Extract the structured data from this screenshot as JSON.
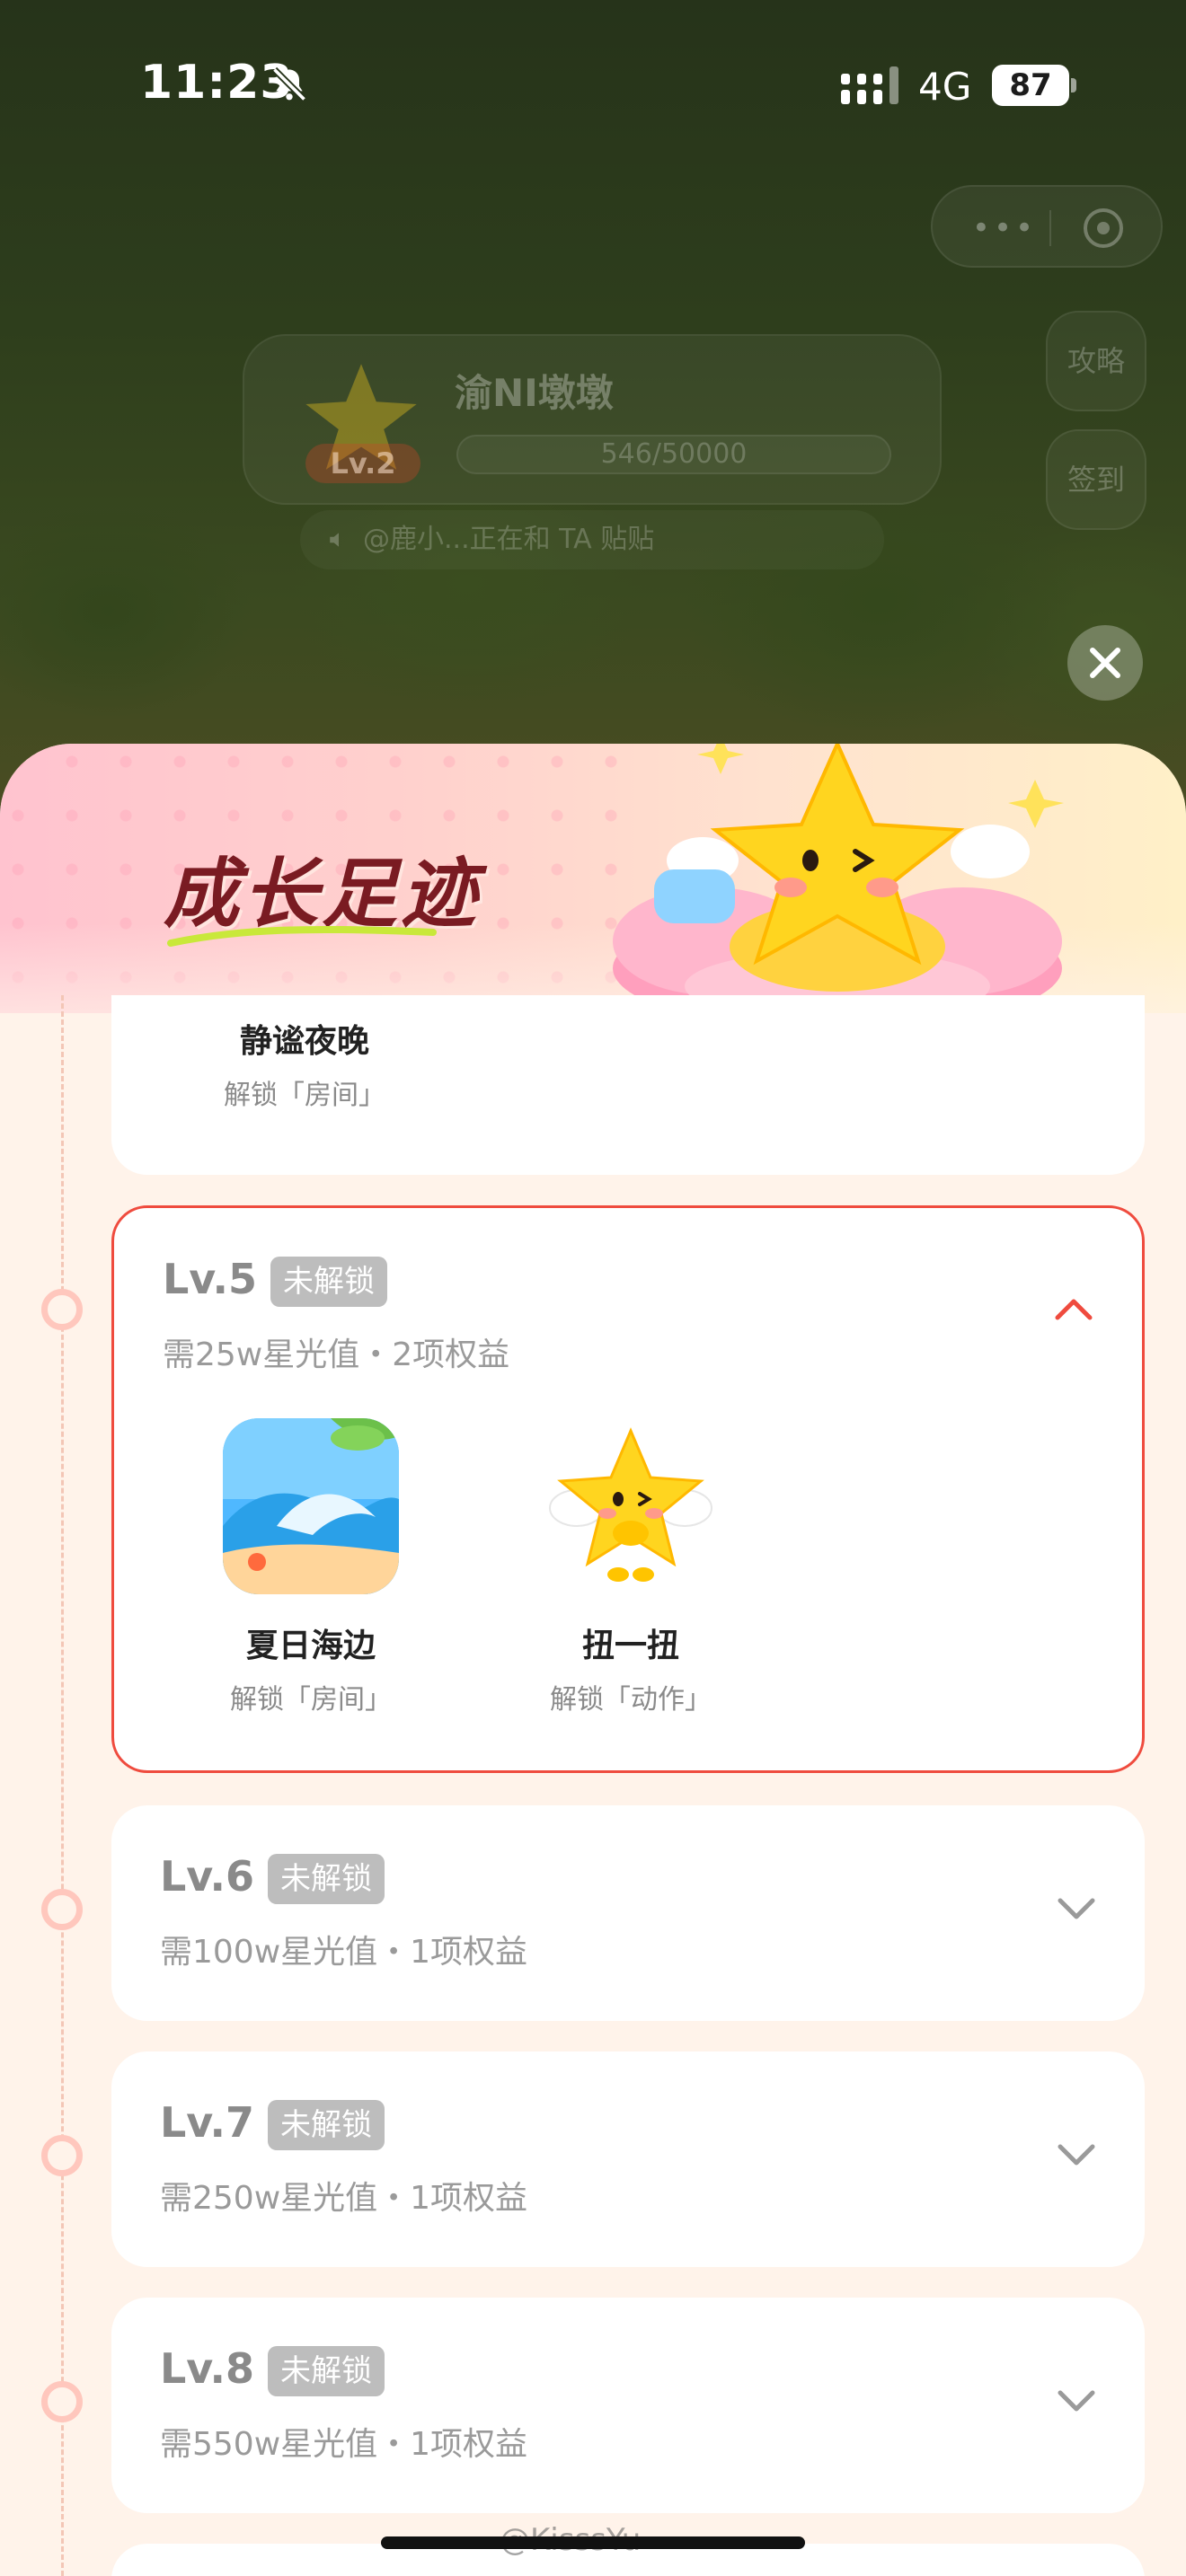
{
  "status_bar": {
    "time": "11:23",
    "network": "4G",
    "battery": "87"
  },
  "background": {
    "profile_name": "渝NI墩墩",
    "profile_level": "Lv.2",
    "profile_progress": "546/50000",
    "side_buttons": [
      "攻略",
      "签到"
    ],
    "notice": "@鹿小...正在和 TA 贴贴",
    "capsule_more": "•••"
  },
  "sheet": {
    "title": "成长足迹",
    "prev_card": {
      "reward_name": "静谧夜晚",
      "reward_sub": "解锁「房间」"
    },
    "levels": [
      {
        "level": "Lv.5",
        "badge": "未解锁",
        "requirement": "需25w星光值・2项权益",
        "expanded": true,
        "rewards": [
          {
            "name": "夏日海边",
            "sub": "解锁「房间」"
          },
          {
            "name": "扭一扭",
            "sub": "解锁「动作」"
          }
        ]
      },
      {
        "level": "Lv.6",
        "badge": "未解锁",
        "requirement": "需100w星光值・1项权益",
        "expanded": false
      },
      {
        "level": "Lv.7",
        "badge": "未解锁",
        "requirement": "需250w星光值・1项权益",
        "expanded": false
      },
      {
        "level": "Lv.8",
        "badge": "未解锁",
        "requirement": "需550w星光值・1项权益",
        "expanded": false
      }
    ]
  },
  "watermark": "@KisssYu",
  "colors": {
    "accent_red": "#ef4b3e",
    "title": "#7a1b22",
    "badge_gray": "#bdbdbd"
  },
  "icons": {
    "bell_off": "bell-slash-icon",
    "close": "close-icon",
    "chevron_up": "chevron-up-icon",
    "chevron_down": "chevron-down-icon"
  }
}
